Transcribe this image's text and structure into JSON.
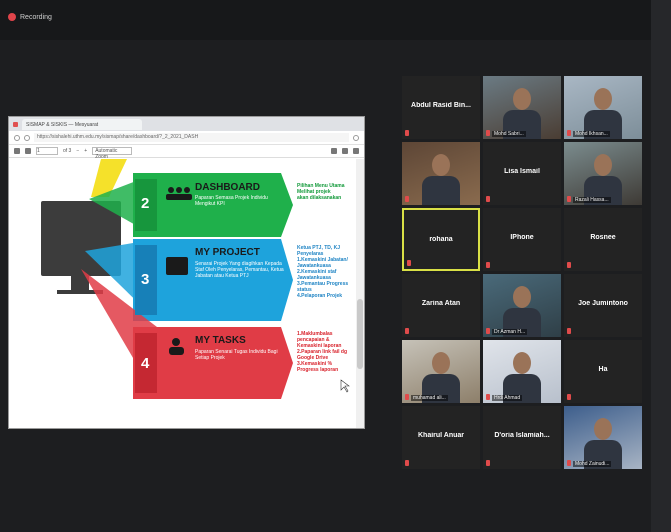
{
  "recording": {
    "label": "Recording"
  },
  "browser": {
    "tab_title": "SISMAP & SISKIS — Mesyuarat",
    "url": "https://sishalehi.uthm.edu.my/sismap/share/dashboard/?_2_2021_DASH",
    "page_value": "1",
    "page_total": "of 3",
    "zoom": "Automatic Zoom"
  },
  "slide": {
    "items": [
      {
        "num": "2",
        "title": "DASHBOARD",
        "desc": "Paparan Semasa Projek Individu Mengikut KPI",
        "side": "Pilihan Menu Utama\nMelihat projek\nakan dilaksanakan",
        "color": "#1fb04b",
        "side_color": "#139a3b"
      },
      {
        "num": "3",
        "title": "MY PROJECT",
        "desc": "Senarai Projek Yang diagihkan Kepada Staf Oleh Penyelaras, Pemantau, Ketua Jabatan atau Ketua PTJ",
        "side": "Ketua PTJ, TD, KJ\nPenyelaras\n1.Kemaskini Jabatan/\nJawatankuasa\n2.Kemaskini staf\nJawatankuasa\n3.Pemantau Progress\nstatus\n4.Pelaporan Projek",
        "color": "#1ea3dc",
        "side_color": "#1f84c4"
      },
      {
        "num": "4",
        "title": "MY TASKS",
        "desc": "Paparan Senarai Tugas Individu Bagi Setiap Projek",
        "side": "1.Maklumbalas\npencapaian &\nKemaskini laporan\n2.Paparan link fail dg\nGoogle Drive\n3.Kemaskini %\nProgress laporan",
        "color": "#e03c46",
        "side_color": "#d8232c"
      }
    ]
  },
  "participants": [
    {
      "name": "Abdul Rasid Bin...",
      "label": "",
      "video": false
    },
    {
      "name": "",
      "label": "Mohd Sabri...",
      "video": true
    },
    {
      "name": "",
      "label": "Mohd Ikhsan...",
      "video": true
    },
    {
      "name": "",
      "label": "",
      "video": true
    },
    {
      "name": "Lisa Ismail",
      "label": "",
      "video": false
    },
    {
      "name": "",
      "label": "Razali Hassa...",
      "video": true
    },
    {
      "name": "rohana",
      "label": "",
      "video": false,
      "active": true
    },
    {
      "name": "IPhone",
      "label": "",
      "video": false
    },
    {
      "name": "Rosnee",
      "label": "",
      "video": false
    },
    {
      "name": "Zarina Atan",
      "label": "",
      "video": false
    },
    {
      "name": "",
      "label": "Dr Azman H...",
      "video": true
    },
    {
      "name": "Joe Jumintono",
      "label": "",
      "video": false
    },
    {
      "name": "",
      "label": "muhamad ali...",
      "video": true
    },
    {
      "name": "",
      "label": "Hrdi Ahmad",
      "video": true
    },
    {
      "name": "Ha",
      "label": "",
      "video": false
    },
    {
      "name": "Khairul Anuar",
      "label": "",
      "video": false
    },
    {
      "name": "D'oria Islamiah...",
      "label": "",
      "video": false
    },
    {
      "name": "",
      "label": "Mohd Zainudi...",
      "video": true
    }
  ],
  "uthm_logo": "UTHM",
  "colors": {
    "accent_active": "#d9e046",
    "mic_muted": "#e04b4b"
  }
}
